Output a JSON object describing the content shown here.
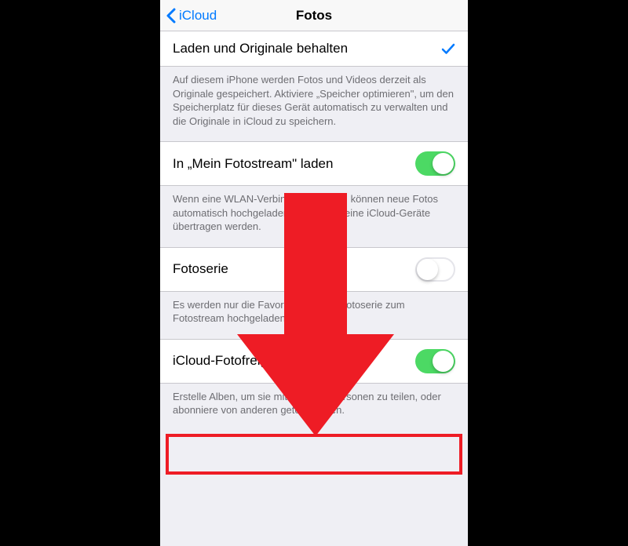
{
  "nav": {
    "back_label": "iCloud",
    "title": "Fotos"
  },
  "rows": {
    "keep_originals": {
      "label": "Laden und Originale behalten",
      "footer": "Auf diesem iPhone werden Fotos und Videos derzeit als Originale gespeichert. Aktiviere „Speicher optimieren\", um den Speicherplatz für dieses Gerät automatisch zu verwalten und die Originale in iCloud zu speichern."
    },
    "photostream": {
      "label": "In „Mein Fotostream\" laden",
      "on": true,
      "footer": "Wenn eine WLAN-Verbindung besteht, können neue Fotos automatisch hochgeladen und an all deine iCloud-Geräte übertragen werden."
    },
    "fotoserie": {
      "label": "Fotoserie",
      "on": false,
      "footer": "Es werden nur die Favoriten aus der Fotoserie zum Fotostream hochgeladen."
    },
    "icloud_sharing": {
      "label": "iCloud-Fotofreigabe",
      "on": true,
      "footer": "Erstelle Alben, um sie mit anderen Personen zu teilen, oder abonniere von anderen geteilte Alben."
    }
  },
  "annotation": {
    "arrow_color": "#ee1c25",
    "highlight_color": "#ee1c25"
  }
}
